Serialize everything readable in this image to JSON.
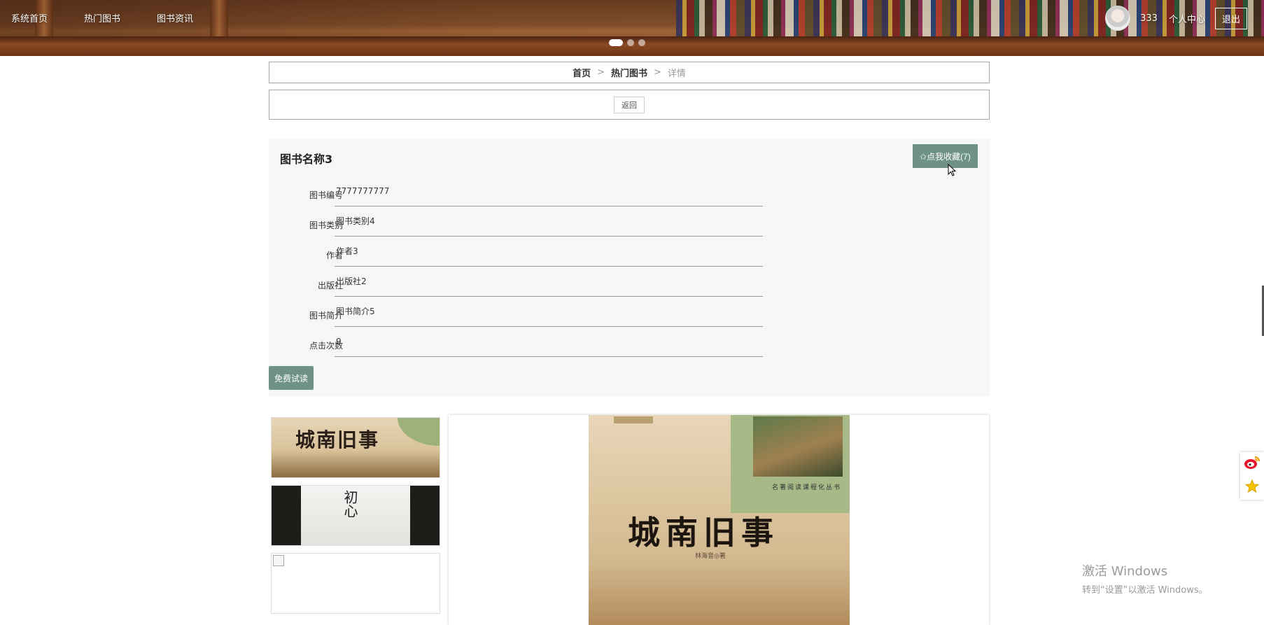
{
  "nav": {
    "items": [
      {
        "label": "系统首页"
      },
      {
        "label": "热门图书"
      },
      {
        "label": "图书资讯"
      }
    ]
  },
  "user": {
    "name": "333",
    "center_label": "个人中心",
    "logout_label": "退出"
  },
  "breadcrumb": {
    "home": "首页",
    "section": "热门图书",
    "current": "详情",
    "separator": ">"
  },
  "back_label": "返回",
  "book": {
    "title": "图书名称3",
    "favorite_label": "✩点我收藏(7)",
    "fields": [
      {
        "label": "图书编号",
        "value": "7777777777"
      },
      {
        "label": "图书类别",
        "value": "图书类别4"
      },
      {
        "label": "作者",
        "value": "作者3"
      },
      {
        "label": "出版社",
        "value": "出版社2"
      },
      {
        "label": "图书简介",
        "value": "图书简介5"
      },
      {
        "label": "点击次数",
        "value": "9"
      }
    ],
    "trial_label": "免费试读"
  },
  "gallery": {
    "thumb1_title": "城南旧事",
    "thumb2_title": "初心",
    "cover_title": "城南旧事",
    "cover_author": "林海音◎著",
    "cover_series": "名著阅读课程化丛书"
  },
  "watermark": {
    "title": "激活 Windows",
    "subtitle": "转到“设置”以激活 Windows。"
  },
  "icons": [
    "weibo-icon",
    "star-icon"
  ],
  "colors": {
    "accent": "#6e9188"
  }
}
